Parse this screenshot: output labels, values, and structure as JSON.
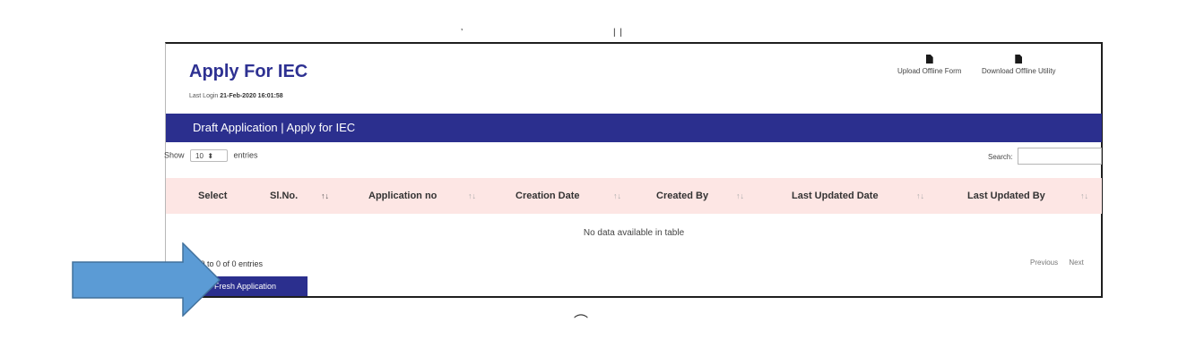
{
  "header": {
    "title": "Apply For IEC",
    "last_login_label": "Last Login",
    "last_login_value": "21-Feb-2020 16:01:58"
  },
  "top_links": {
    "upload": "Upload Offline Form",
    "download": "Download Offline Utility"
  },
  "panel": {
    "heading": "Draft Application | Apply for IEC"
  },
  "length": {
    "show": "Show",
    "selected": "10",
    "entries": "entries"
  },
  "search": {
    "label": "Search:",
    "value": ""
  },
  "table": {
    "columns": [
      "Select",
      "Sl.No.",
      "Application no",
      "Creation Date",
      "Created By",
      "Last Updated Date",
      "Last Updated By"
    ],
    "sort_icon": "↑↓",
    "empty_text": "No data available in table"
  },
  "footer": {
    "info": "ing 0 to 0 of 0 entries",
    "previous": "Previous",
    "next": "Next"
  },
  "fresh_button": "Fresh Application",
  "colors": {
    "brand": "#2b2f8e",
    "header_row": "#fde6e4",
    "arrow_fill": "#5b9bd5",
    "arrow_stroke": "#41719c"
  },
  "icons": [
    "document-icon",
    "sort-icon",
    "select-caret-icon",
    "callout-arrow"
  ]
}
